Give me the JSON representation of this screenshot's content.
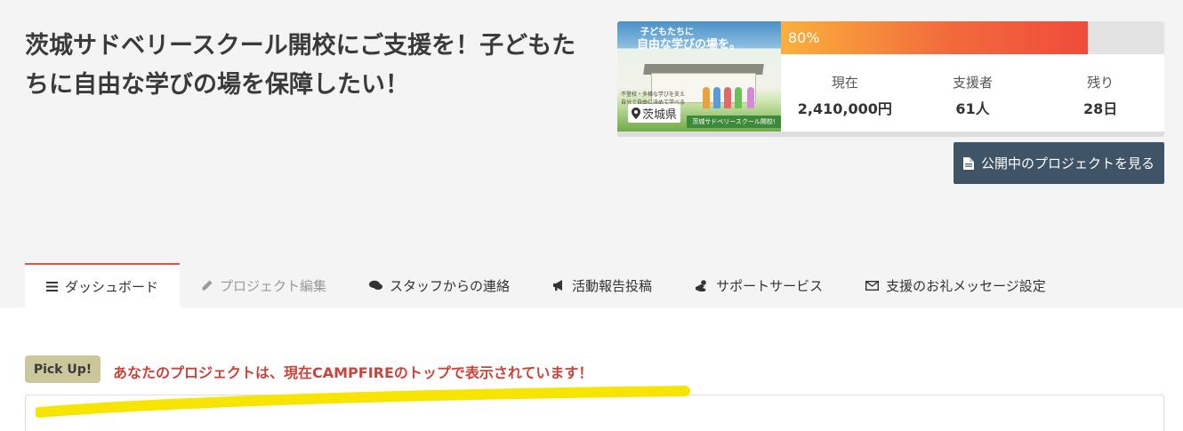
{
  "project": {
    "title": "茨城サドベリースクール開校にご支援を！子どもたちに自由な学びの場を保障したい！",
    "thumbnail": {
      "headline_small": "子どもたちに",
      "headline_large": "自由な学びの場を。",
      "caption": "不登校・多様な学びを支え 自分で自由に決めて学べる",
      "location": "茨城県",
      "ribbon": "茨城サドベリースクール開校!"
    },
    "progress": {
      "percent": 80,
      "label": "80%"
    },
    "stats": [
      {
        "label": "現在",
        "value": "2,410,000円"
      },
      {
        "label": "支援者",
        "value": "61人"
      },
      {
        "label": "残り",
        "value": "28日"
      }
    ],
    "view_button": "公開中のプロジェクトを見る"
  },
  "tabs": [
    {
      "label": "ダッシュボード",
      "icon": "menu-icon",
      "state": "active"
    },
    {
      "label": "プロジェクト編集",
      "icon": "pencil-icon",
      "state": "disabled"
    },
    {
      "label": "スタッフからの連絡",
      "icon": "chat-icon",
      "state": "normal"
    },
    {
      "label": "活動報告投稿",
      "icon": "megaphone-icon",
      "state": "normal"
    },
    {
      "label": "サポートサービス",
      "icon": "handshake-icon",
      "state": "normal"
    },
    {
      "label": "支援のお礼メッセージ設定",
      "icon": "envelope-icon",
      "state": "normal"
    }
  ],
  "pickup": {
    "badge": "Pick Up!",
    "message": "あなたのプロジェクトは、現在CAMPFIREのトップで表示されています！"
  },
  "colors": {
    "accent_red": "#d9534f",
    "button_dark": "#3f5467",
    "pickup_text": "#c7453b",
    "highlight_yellow": "#f7e400"
  }
}
